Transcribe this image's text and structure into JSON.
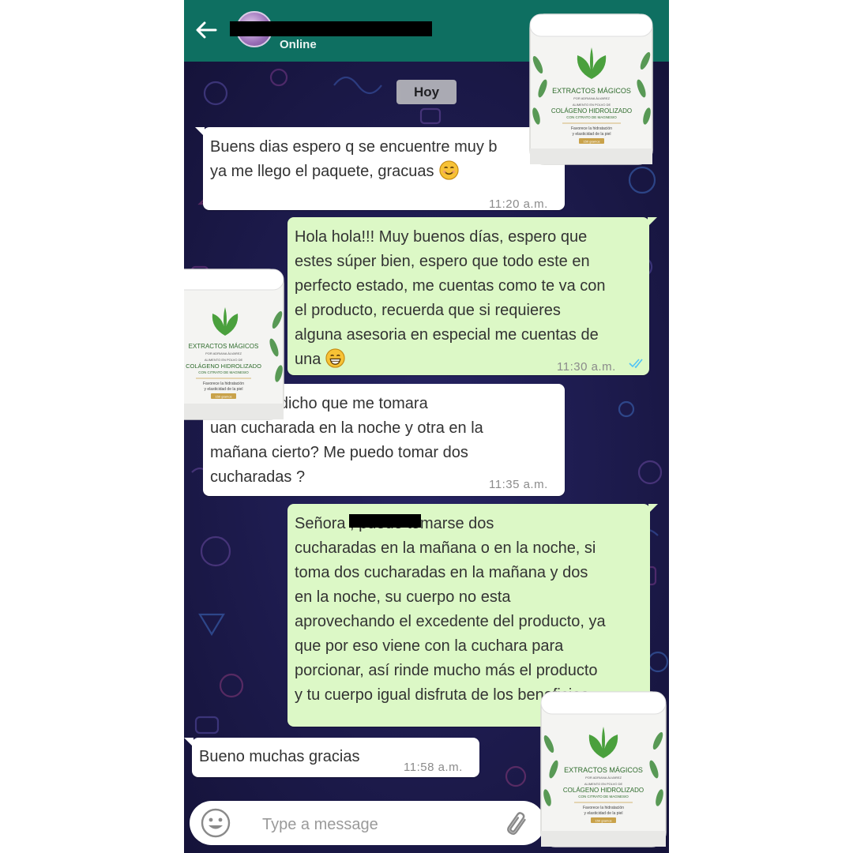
{
  "header": {
    "status": "Online",
    "back_icon": "arrow-left-icon"
  },
  "date_chip": "Hoy",
  "messages": [
    {
      "direction": "in",
      "text": "Buens dias espero q se encuentre muy b\nya me llego el paquete, gracuas",
      "emoji": "smiling-face-icon",
      "time": "11:20 a.m."
    },
    {
      "direction": "out",
      "text": "Hola hola!!! Muy buenos días, espero que\nestes súper bien, espero que todo este en\nperfecto estado, me cuentas como te va con\nel producto, recuerda que si requieres\nalguna asesoria en especial me cuentas de\nuna",
      "emoji": "grinning-face-icon",
      "time": "11:30 a.m.",
      "read": true
    },
    {
      "direction": "in",
      "text": "me habia dicho que me tomara\nuan cucharada en la noche y otra en la\nmañana cierto? Me puedo tomar dos\ncucharadas ?",
      "time": "11:35 a.m."
    },
    {
      "direction": "out",
      "text": "Señora             , puede tomarse dos\ncucharadas en la mañana o en la noche, si\ntoma dos cucharadas en la mañana y dos\nen la noche, su cuerpo no esta\naprovechando el excedente del producto, ya\nque por eso viene con la cuchara para\nporcionar, así rinde mucho más el producto\ny tu cuerpo igual disfruta de los beneficios"
    },
    {
      "direction": "in",
      "text": "Bueno muchas gracias",
      "time": "11:58 a.m."
    }
  ],
  "input": {
    "placeholder": "Type a message"
  },
  "product": {
    "brand": "EXTRACTOS MÁGICOS",
    "by": "POR ADRIANA ÁLVAREZ",
    "line1": "ALIMENTO EN POLVO DE",
    "name": "COLÁGENO HIDROLIZADO",
    "sub": "CON CITRATO DE MAGNESIO",
    "benefit1": "Favorece la hidratación",
    "benefit2": "y elasticidad de la piel",
    "weight": "150 gramos"
  },
  "colors": {
    "header": "#0e6f61",
    "outgoing_bubble": "#dcf8c6",
    "incoming_bubble": "#ffffff",
    "wallpaper": "#1c1a45",
    "read_ticks": "#4fc3f7"
  }
}
